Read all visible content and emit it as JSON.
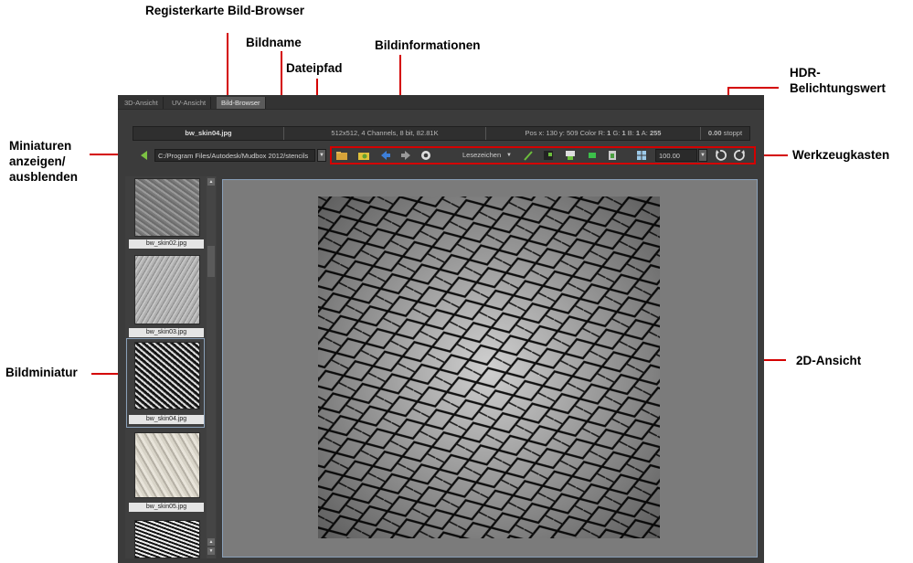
{
  "callouts": {
    "tab_label": "Registerkarte Bild-Browser",
    "image_name": "Bildname",
    "file_path": "Dateipfad",
    "image_info": "Bildinformationen",
    "hdr_line1": "HDR-",
    "hdr_line2": "Belichtungswert",
    "thumbs_line1": "Miniaturen",
    "thumbs_line2": "anzeigen/",
    "thumbs_line3": "ausblenden",
    "toolbox": "Werkzeugkasten",
    "thumbnail": "Bildminiatur",
    "view_2d": "2D-Ansicht"
  },
  "tabs": [
    {
      "label": "3D-Ansicht"
    },
    {
      "label": "UV-Ansicht"
    },
    {
      "label": "Bild-Browser"
    }
  ],
  "infobar": {
    "filename": "bw_skin04.jpg",
    "details": "512x512, 4 Channels, 8 bit,  82.81K",
    "pos_prefix": "Pos x: 130 y: 509 Color R:",
    "r": "1",
    "g_label": "G:",
    "g": "1",
    "b_label": "B:",
    "b": "1",
    "a_label": "A:",
    "a": "255",
    "exposure_value": "0.00",
    "exposure_unit": "stoppt"
  },
  "toolbar": {
    "path": "C:/Program Files/Autodesk/Mudbox 2012/stencils",
    "bookmarks": "Lesezeichen",
    "zoom": "100.00"
  },
  "thumbnails": [
    {
      "label": "bw_skin02.jpg"
    },
    {
      "label": "bw_skin03.jpg"
    },
    {
      "label": "bw_skin04.jpg"
    },
    {
      "label": "bw_skin05.jpg"
    }
  ],
  "colors": {
    "annotation_red": "#d40000",
    "panel_bg": "#3b3b3b",
    "view_bg": "#7b7b7b"
  }
}
